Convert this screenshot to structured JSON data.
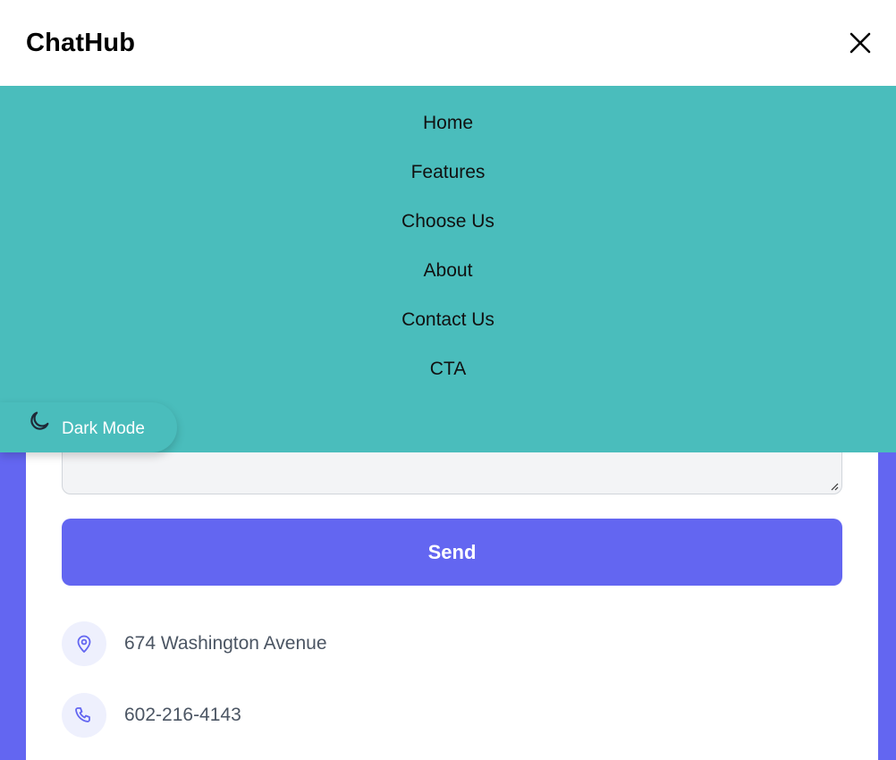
{
  "header": {
    "brand": "ChatHub",
    "close_icon": "close-icon"
  },
  "menu": {
    "items": [
      {
        "label": "Home"
      },
      {
        "label": "Features"
      },
      {
        "label": "Choose Us"
      },
      {
        "label": "About"
      },
      {
        "label": "Contact Us"
      },
      {
        "label": "CTA"
      }
    ]
  },
  "dark_mode": {
    "label": "Dark Mode",
    "icon": "moon-icon"
  },
  "contact": {
    "message_value": "",
    "send_label": "Send",
    "address": "674 Washington Avenue",
    "address_icon": "map-pin-icon",
    "phone": "602-216-4143",
    "phone_icon": "phone-icon"
  },
  "colors": {
    "primary": "#6366f1",
    "menu_bg": "#4abdbc",
    "icon_bg": "#eef0fd"
  }
}
